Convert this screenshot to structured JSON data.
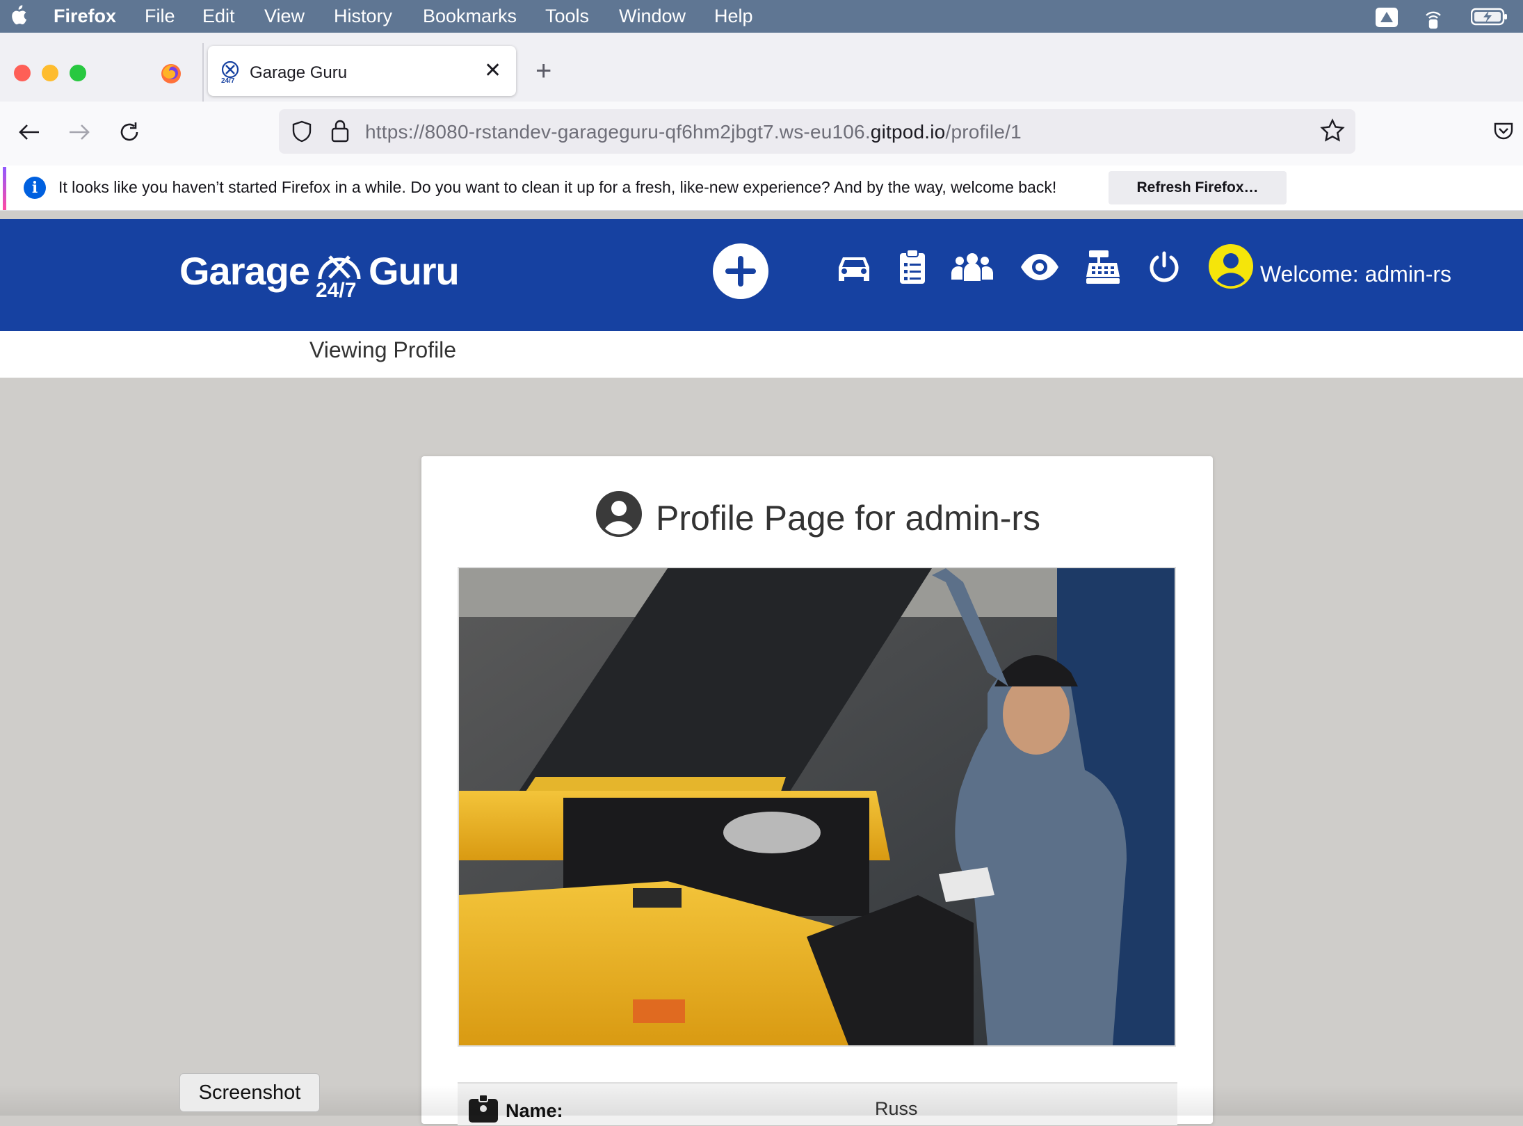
{
  "menubar": {
    "app_name": "Firefox",
    "items": [
      "File",
      "Edit",
      "View",
      "History",
      "Bookmarks",
      "Tools",
      "Window",
      "Help"
    ]
  },
  "browser": {
    "tab_title": "Garage Guru",
    "url_prefix": "https://8080-rstandev-garageguru-qf6hm2jbgt7.ws-eu106.",
    "url_host": "gitpod.io",
    "url_path": "/profile/1",
    "notification": {
      "text": "It looks like you haven’t started Firefox in a while. Do you want to clean it up for a fresh, like-new experience? And by the way, welcome back!",
      "button": "Refresh Firefox…"
    }
  },
  "site": {
    "logo": {
      "left": "Garage",
      "right": "Guru",
      "sub": "24/7"
    },
    "welcome": "Welcome: admin-rs",
    "subtitle": "Viewing Profile",
    "accent_color": "#1641a1",
    "avatar_color": "#f5e50a"
  },
  "profile": {
    "title": "Profile Page for admin-rs",
    "photo_alt": "mechanic-photo",
    "name_label": "Name:",
    "name_value": "Russ"
  },
  "tooltip": "Screenshot"
}
